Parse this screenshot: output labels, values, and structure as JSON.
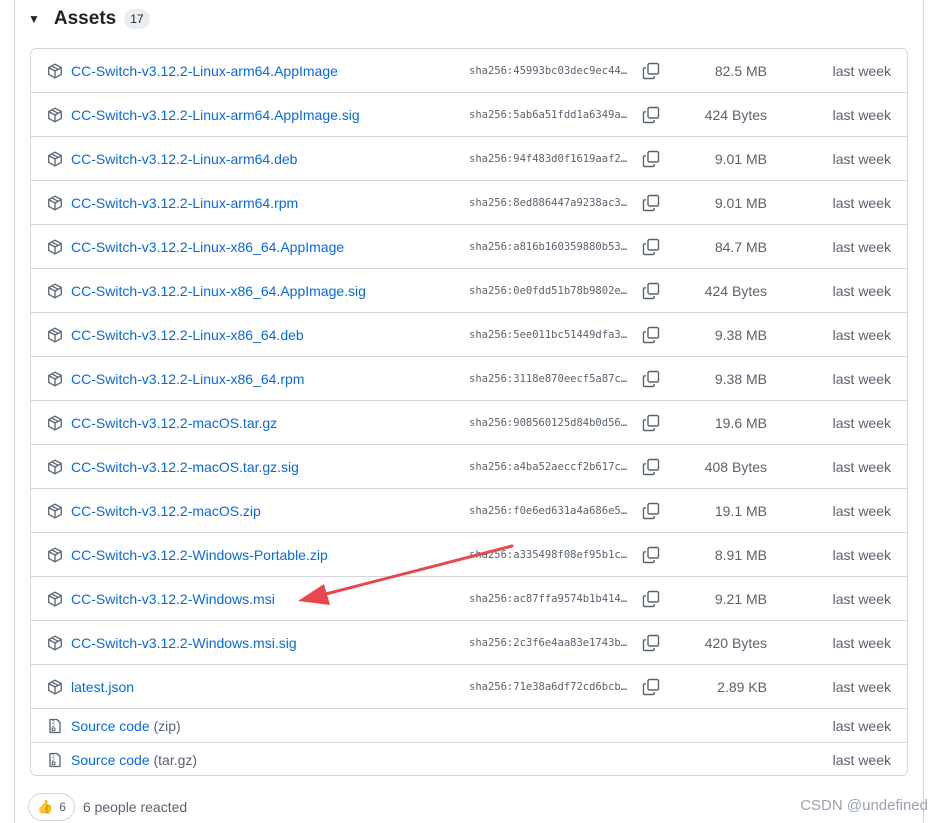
{
  "assets_section": {
    "title": "Assets",
    "count": "17",
    "assets": [
      {
        "name": "CC-Switch-v3.12.2-Linux-arm64.AppImage",
        "sha": "sha256:45993bc03dec9ec44…",
        "size": "82.5 MB",
        "date": "last week"
      },
      {
        "name": "CC-Switch-v3.12.2-Linux-arm64.AppImage.sig",
        "sha": "sha256:5ab6a51fdd1a6349a…",
        "size": "424 Bytes",
        "date": "last week"
      },
      {
        "name": "CC-Switch-v3.12.2-Linux-arm64.deb",
        "sha": "sha256:94f483d0f1619aaf2…",
        "size": "9.01 MB",
        "date": "last week"
      },
      {
        "name": "CC-Switch-v3.12.2-Linux-arm64.rpm",
        "sha": "sha256:8ed886447a9238ac3…",
        "size": "9.01 MB",
        "date": "last week"
      },
      {
        "name": "CC-Switch-v3.12.2-Linux-x86_64.AppImage",
        "sha": "sha256:a816b160359880b53…",
        "size": "84.7 MB",
        "date": "last week"
      },
      {
        "name": "CC-Switch-v3.12.2-Linux-x86_64.AppImage.sig",
        "sha": "sha256:0e0fdd51b78b9802e…",
        "size": "424 Bytes",
        "date": "last week"
      },
      {
        "name": "CC-Switch-v3.12.2-Linux-x86_64.deb",
        "sha": "sha256:5ee011bc51449dfa3…",
        "size": "9.38 MB",
        "date": "last week"
      },
      {
        "name": "CC-Switch-v3.12.2-Linux-x86_64.rpm",
        "sha": "sha256:3118e870eecf5a87c…",
        "size": "9.38 MB",
        "date": "last week"
      },
      {
        "name": "CC-Switch-v3.12.2-macOS.tar.gz",
        "sha": "sha256:908560125d84b0d56…",
        "size": "19.6 MB",
        "date": "last week"
      },
      {
        "name": "CC-Switch-v3.12.2-macOS.tar.gz.sig",
        "sha": "sha256:a4ba52aeccf2b617c…",
        "size": "408 Bytes",
        "date": "last week"
      },
      {
        "name": "CC-Switch-v3.12.2-macOS.zip",
        "sha": "sha256:f0e6ed631a4a686e5…",
        "size": "19.1 MB",
        "date": "last week"
      },
      {
        "name": "CC-Switch-v3.12.2-Windows-Portable.zip",
        "sha": "sha256:a335498f08ef95b1c…",
        "size": "8.91 MB",
        "date": "last week"
      },
      {
        "name": "CC-Switch-v3.12.2-Windows.msi",
        "sha": "sha256:ac87ffa9574b1b414…",
        "size": "9.21 MB",
        "date": "last week"
      },
      {
        "name": "CC-Switch-v3.12.2-Windows.msi.sig",
        "sha": "sha256:2c3f6e4aa83e1743b…",
        "size": "420 Bytes",
        "date": "last week"
      },
      {
        "name": "latest.json",
        "sha": "sha256:71e38a6df72cd6bcb…",
        "size": "2.89 KB",
        "date": "last week"
      }
    ],
    "source_code": [
      {
        "label": "Source code",
        "suffix": "(zip)",
        "date": "last week"
      },
      {
        "label": "Source code",
        "suffix": "(tar.gz)",
        "date": "last week"
      }
    ]
  },
  "reactions": {
    "emoji": "👍",
    "count": "6",
    "text": "6 people reacted"
  },
  "watermark": "CSDN @undefined",
  "colors": {
    "link": "#0969da",
    "muted": "#59636e",
    "border": "#d0d7de",
    "annotation_arrow": "#e5484d"
  },
  "icons": {
    "package": "package-icon",
    "zip": "file-zip-icon",
    "copy": "copy-icon",
    "caret": "triangle-down-icon"
  }
}
